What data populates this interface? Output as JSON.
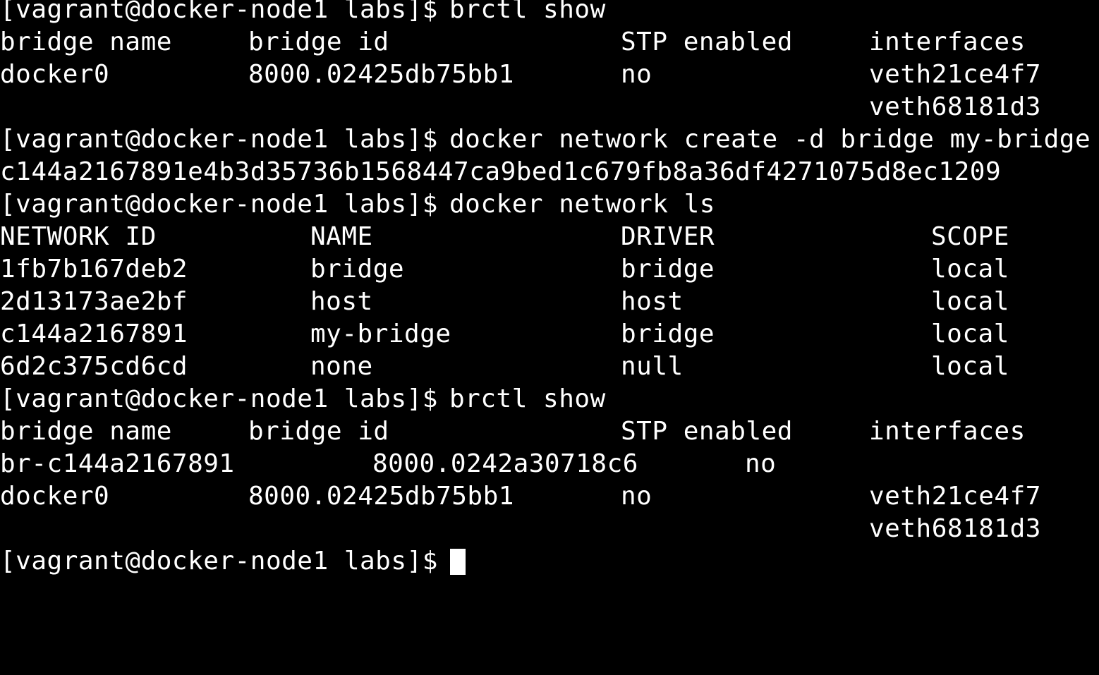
{
  "terminal": {
    "prompt": "[vagrant@docker-node1 labs]$",
    "commands": {
      "brctl_show_1": "brctl show",
      "network_create": "docker network create -d bridge my-bridge",
      "network_ls": "docker network ls",
      "brctl_show_2": "brctl show"
    },
    "network_create_output": "c144a2167891e4b3d35736b1568447ca9bed1c679fb8a36df4271075d8ec1209",
    "brctl_headers": {
      "bridge_name": "bridge name",
      "bridge_id": "bridge id",
      "stp_enabled": "STP enabled",
      "interfaces": "interfaces"
    },
    "brctl_show_1_rows": [
      {
        "bridge_name": "docker0",
        "bridge_id": "8000.02425db75bb1",
        "stp": "no",
        "interfaces": [
          "veth21ce4f7",
          "veth68181d3"
        ]
      }
    ],
    "network_ls_headers": {
      "network_id": "NETWORK ID",
      "name": "NAME",
      "driver": "DRIVER",
      "scope": "SCOPE"
    },
    "network_ls_rows": [
      {
        "id": "1fb7b167deb2",
        "name": "bridge",
        "driver": "bridge",
        "scope": "local"
      },
      {
        "id": "2d13173ae2bf",
        "name": "host",
        "driver": "host",
        "scope": "local"
      },
      {
        "id": "c144a2167891",
        "name": "my-bridge",
        "driver": "bridge",
        "scope": "local"
      },
      {
        "id": "6d2c375cd6cd",
        "name": "none",
        "driver": "null",
        "scope": "local"
      }
    ],
    "brctl_show_2_rows": [
      {
        "bridge_name": "br-c144a2167891",
        "bridge_id": "8000.0242a30718c6",
        "stp": "no",
        "interfaces": []
      },
      {
        "bridge_name": "docker0",
        "bridge_id": "8000.02425db75bb1",
        "stp": "no",
        "interfaces": [
          "veth21ce4f7",
          "veth68181d3"
        ]
      }
    ]
  },
  "colors": {
    "background": "#000000",
    "foreground": "#ffffff"
  }
}
